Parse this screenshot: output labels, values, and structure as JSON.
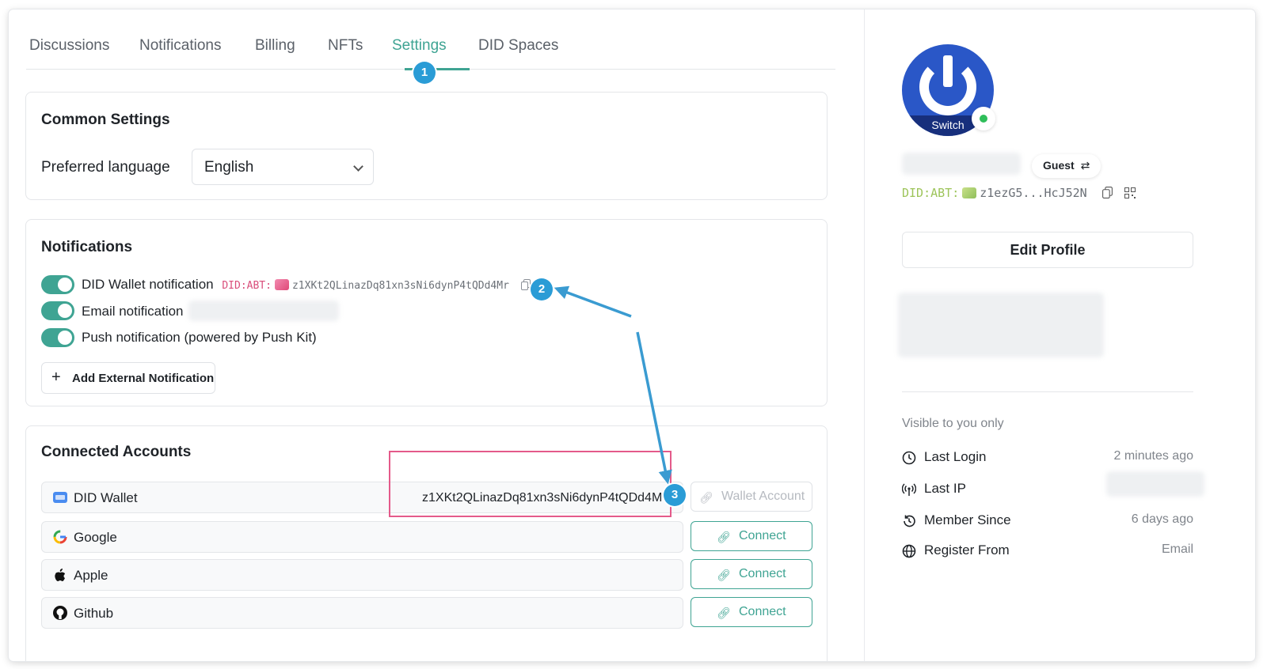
{
  "tabs": [
    {
      "label": "Discussions"
    },
    {
      "label": "Notifications"
    },
    {
      "label": "Billing"
    },
    {
      "label": "NFTs"
    },
    {
      "label": "Settings",
      "active": true
    },
    {
      "label": "DID Spaces"
    }
  ],
  "annotations": {
    "b1": "1",
    "b2": "2",
    "b3": "3"
  },
  "common": {
    "title": "Common Settings",
    "language_label": "Preferred language",
    "language_value": "English"
  },
  "notifications": {
    "title": "Notifications",
    "wallet_label": "DID Wallet notification",
    "wallet_did_prefix": "DID:ABT:",
    "wallet_did": "z1XKt2QLinazDq81xn3sNi6dynP4tQDd4Mr",
    "email_label": "Email notification",
    "push_label": "Push notification (powered by Push Kit)",
    "add_label": "Add External Notification"
  },
  "accounts": {
    "title": "Connected Accounts",
    "rows": [
      {
        "name": "DID Wallet",
        "value": "z1XKt2QLinazDq81xn3sNi6dynP4tQDd4M",
        "button": "Wallet Account"
      },
      {
        "name": "Google",
        "button": "Connect"
      },
      {
        "name": "Apple",
        "button": "Connect"
      },
      {
        "name": "Github",
        "button": "Connect"
      }
    ]
  },
  "profile": {
    "avatar_switch": "Switch",
    "role": "Guest",
    "role_icon": "swap-icon",
    "did_prefix": "DID:ABT:",
    "did_short": "z1ezG5...HcJ52N",
    "edit_label": "Edit Profile",
    "visible_note": "Visible to you only",
    "info": [
      {
        "icon": "clock-icon",
        "label": "Last Login",
        "value": "2 minutes ago"
      },
      {
        "icon": "signal-icon",
        "label": "Last IP",
        "value": ""
      },
      {
        "icon": "history-icon",
        "label": "Member Since",
        "value": "6 days ago"
      },
      {
        "icon": "globe-icon",
        "label": "Register From",
        "value": "Email"
      }
    ]
  },
  "colors": {
    "accent": "#3fa493",
    "badge": "#2a9cd6",
    "highlight": "#e45a8a"
  }
}
